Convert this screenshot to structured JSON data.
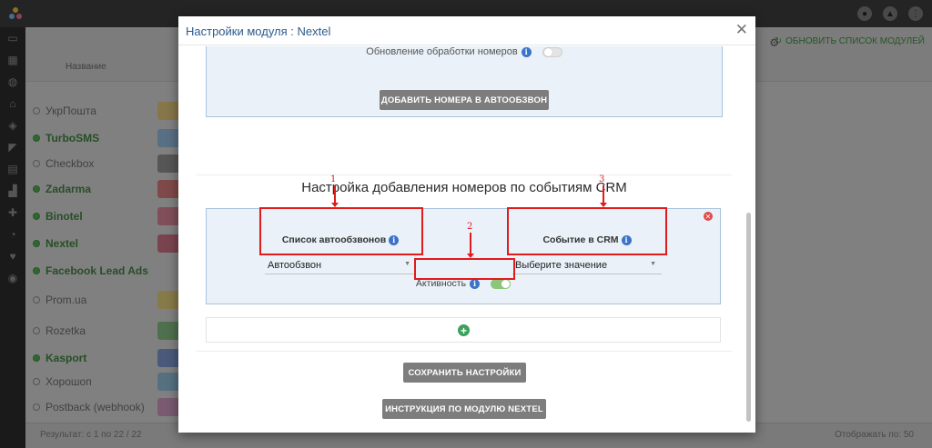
{
  "background": {
    "column_name": "Название",
    "refresh_label": "ОБНОВИТЬ СПИСОК МОДУЛЕЙ",
    "modules": [
      {
        "label": "УкрПошта",
        "active": false
      },
      {
        "label": "TurboSMS",
        "active": true
      },
      {
        "label": "Checkbox",
        "active": false
      },
      {
        "label": "Zadarma",
        "active": true
      },
      {
        "label": "Binotel",
        "active": true
      },
      {
        "label": "Nextel",
        "active": true
      },
      {
        "label": "Facebook Lead Ads",
        "active": true
      },
      {
        "label": "Prom.ua",
        "active": false
      },
      {
        "label": "Rozetka",
        "active": false
      },
      {
        "label": "Kasport",
        "active": true
      },
      {
        "label": "Хорошоп",
        "active": false
      },
      {
        "label": "Postback (webhook)",
        "active": false
      }
    ],
    "result_text": "Результат: с 1 по 22 / 22",
    "per_page_label": "Отображать по:",
    "per_page_value": "50"
  },
  "modal": {
    "title": "Настройки модуля : Nextel",
    "close_glyph": "✕",
    "renumber_label": "Обновление обработки номеров",
    "add_numbers_button": "ДОБАВИТЬ НОМЕРА В АВТООБЗВОН",
    "crm_section_title": "Настройка добавления номеров по событиям CRM",
    "autodial_list_label": "Список автообзвонов",
    "autodial_list_value": "Автообзвон",
    "crm_event_label": "Событие в CRM",
    "crm_event_value": "Выберите значение",
    "active_label": "Активность",
    "save_button": "СОХРАНИТЬ НАСТРОЙКИ",
    "instructions_button": "ИНСТРУКЦИЯ ПО МОДУЛЮ NEXTEL"
  },
  "annotations": {
    "marker_1": "1",
    "marker_2": "2",
    "marker_3": "3"
  },
  "colors": {
    "modal_title": "#2d5a8c",
    "panel_bg": "#eaf1f8",
    "panel_border": "#a9c3de",
    "annotation_red": "#e01b1b",
    "toggle_on": "#8cc67a",
    "add_icon": "#3aa25a",
    "button_grey": "#7d7d7d"
  },
  "icons": {
    "info": "info-icon",
    "remove": "remove-circle-icon",
    "add": "plus-circle-icon",
    "close": "close-icon",
    "caret": "caret-down-icon"
  }
}
